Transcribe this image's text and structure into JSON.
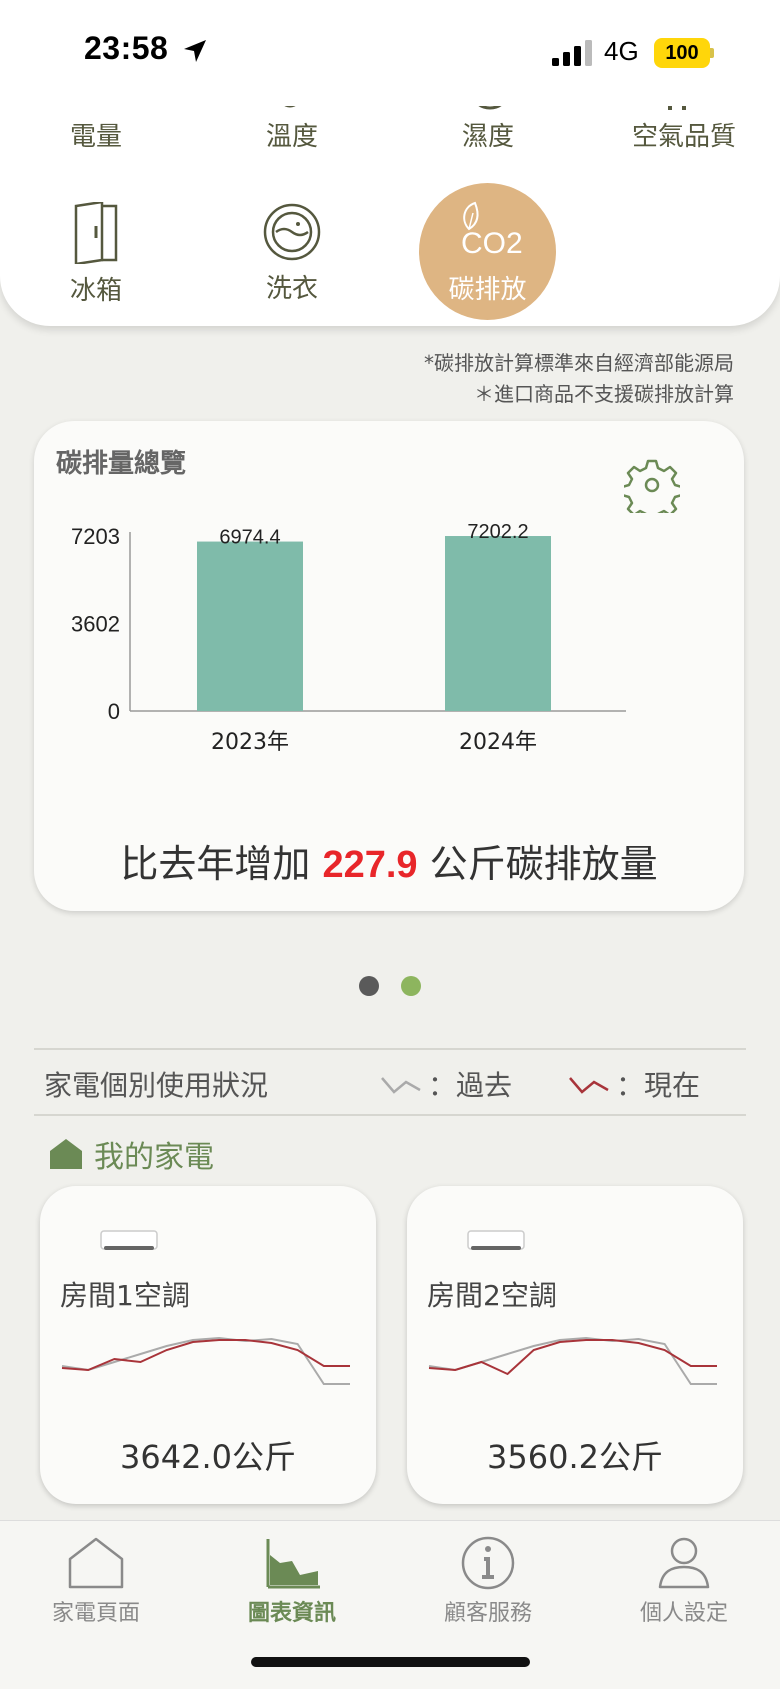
{
  "status_bar": {
    "time": "23:58",
    "network": "4G",
    "battery": "100"
  },
  "categories": [
    {
      "label": "電量",
      "icon": "power-icon"
    },
    {
      "label": "溫度",
      "icon": "temperature-icon"
    },
    {
      "label": "濕度",
      "icon": "humidity-icon"
    },
    {
      "label": "空氣品質",
      "icon": "air-quality-icon"
    },
    {
      "label": "冰箱",
      "icon": "fridge-icon"
    },
    {
      "label": "洗衣",
      "icon": "washing-machine-icon"
    },
    {
      "label": "碳排放",
      "icon": "co2-icon",
      "selected": true
    }
  ],
  "co2_icon_text": "CO2",
  "notes": [
    "*碳排放計算標準來自經濟部能源局",
    "＊進口商品不支援碳排放計算"
  ],
  "overview": {
    "title": "碳排量總覽",
    "summary_prefix": "比去年增加",
    "summary_value": "227.9",
    "summary_suffix": "公斤碳排放量"
  },
  "chart_data": {
    "type": "bar",
    "title": "",
    "categories": [
      "2023年",
      "2024年"
    ],
    "values": [
      6974.4,
      7202.2
    ],
    "value_labels": [
      "6974.4",
      "7202.2"
    ],
    "yticks": [
      0,
      3602,
      7203
    ],
    "ytick_labels": [
      "0",
      "3602",
      "7203"
    ],
    "ylim": [
      0,
      7203
    ],
    "bar_color": "#7fbbaa",
    "grid": false
  },
  "pager": {
    "pages": 2,
    "active_index": 1,
    "colors": [
      "#5a5a5a",
      "#8db55e"
    ]
  },
  "usage": {
    "title": "家電個別使用狀況",
    "legend_past": "：過去",
    "legend_now": "：現在",
    "past_color": "#aaaaaa",
    "now_color": "#a8343a"
  },
  "my_appliances": {
    "label": "我的家電",
    "icon": "home-filled-icon"
  },
  "appliances": [
    {
      "name": "房間1空調",
      "value": "3642.0公斤",
      "icon": "air-conditioner-icon",
      "past": [
        40,
        44,
        36,
        28,
        20,
        14,
        12,
        15,
        13,
        18,
        58,
        58
      ],
      "now": [
        42,
        44,
        33,
        36,
        24,
        16,
        14,
        14,
        17,
        24,
        40,
        40
      ]
    },
    {
      "name": "房間2空調",
      "value": "3560.2公斤",
      "icon": "air-conditioner-icon",
      "past": [
        40,
        44,
        36,
        28,
        20,
        14,
        12,
        15,
        13,
        18,
        58,
        58
      ],
      "now": [
        42,
        44,
        36,
        48,
        24,
        16,
        14,
        14,
        17,
        24,
        40,
        40
      ]
    }
  ],
  "bottom_nav": [
    {
      "label": "家電頁面",
      "icon": "house-icon"
    },
    {
      "label": "圖表資訊",
      "icon": "chart-icon",
      "active": true
    },
    {
      "label": "顧客服務",
      "icon": "info-icon"
    },
    {
      "label": "個人設定",
      "icon": "user-icon"
    }
  ],
  "colors": {
    "accent_green": "#6b8a55",
    "co2_selected": "#deb583",
    "highlight_red": "#e8262a"
  }
}
